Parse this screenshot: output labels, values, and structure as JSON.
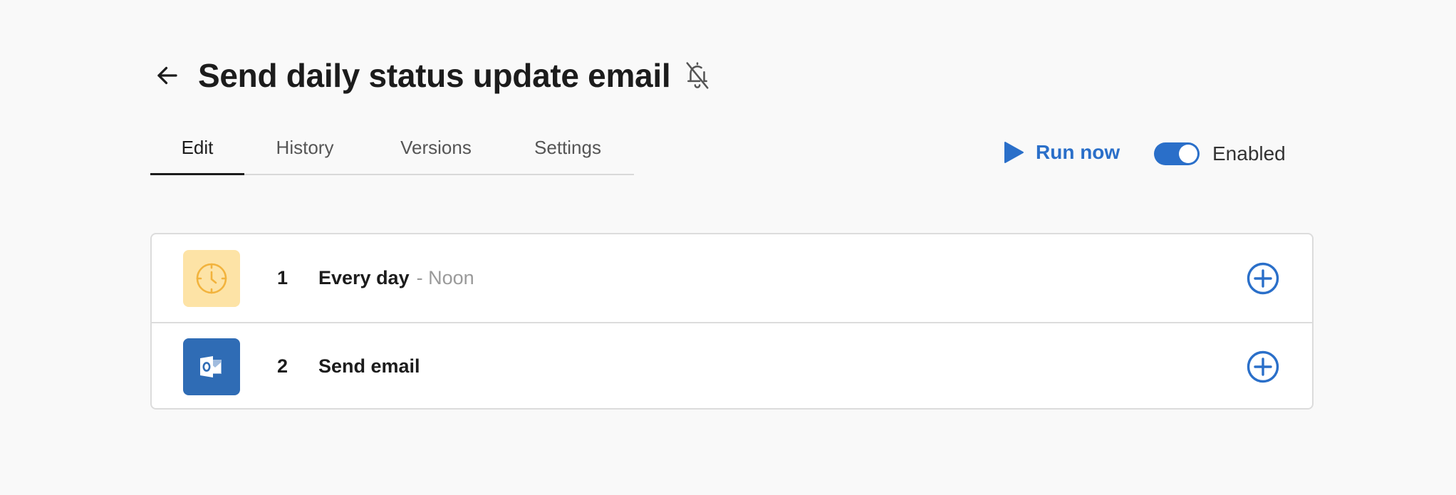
{
  "header": {
    "title": "Send daily status update email",
    "back_icon": "arrow-left-icon",
    "bell_icon": "bell-off-icon"
  },
  "tabs": [
    {
      "label": "Edit",
      "active": true
    },
    {
      "label": "History",
      "active": false
    },
    {
      "label": "Versions",
      "active": false
    },
    {
      "label": "Settings",
      "active": false
    }
  ],
  "actions": {
    "run_now_label": "Run now",
    "enabled_label": "Enabled",
    "enabled": true
  },
  "steps": [
    {
      "number": "1",
      "title": "Every day",
      "subtitle": "- Noon",
      "icon": "clock-icon"
    },
    {
      "number": "2",
      "title": "Send email",
      "subtitle": "",
      "icon": "outlook-icon"
    }
  ],
  "colors": {
    "accent": "#2a6fc9",
    "background": "#f9f9f9",
    "clock_tile": "#fde3a6",
    "clock_stroke": "#f2b33d",
    "outlook_tile": "#2f6cb5"
  }
}
